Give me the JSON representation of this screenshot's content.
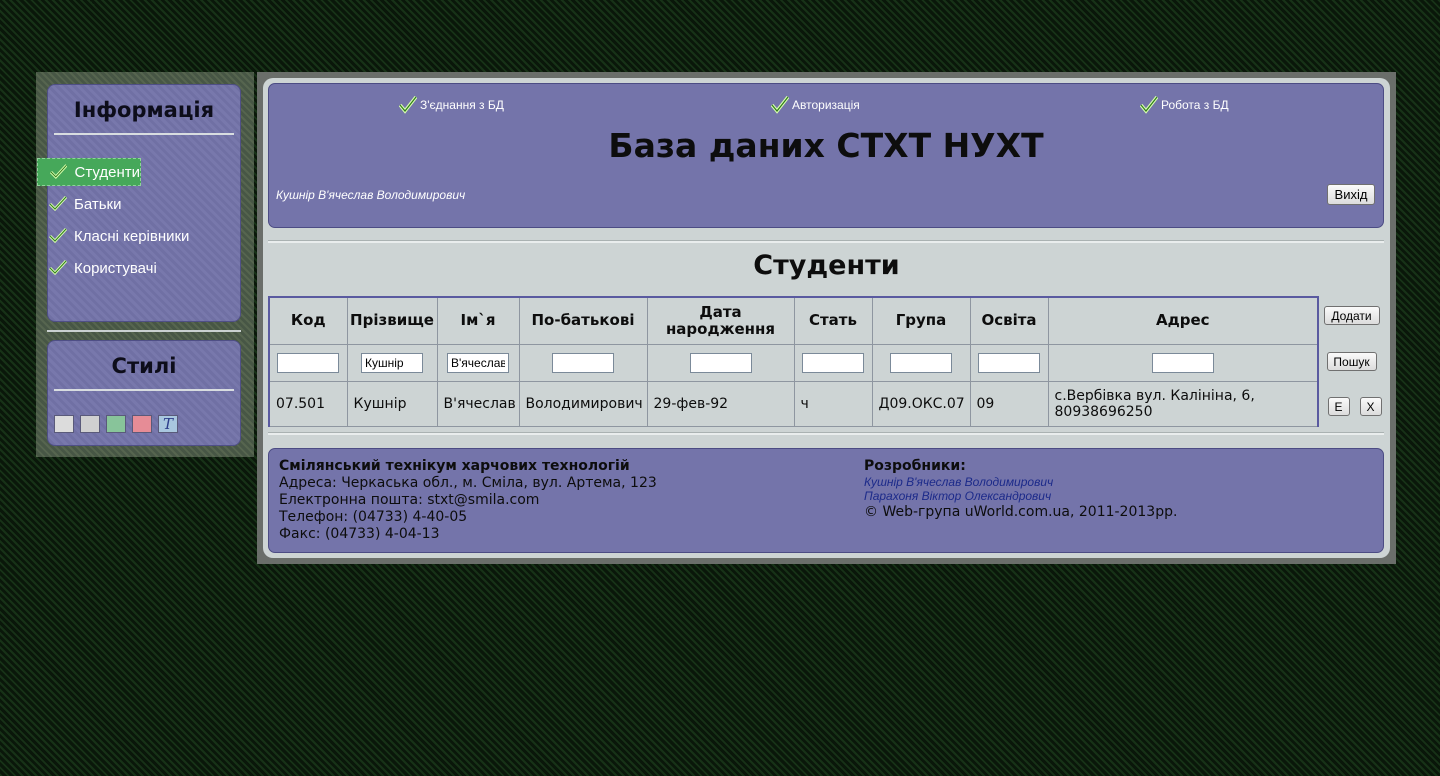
{
  "sidebar": {
    "info_title": "Інформація",
    "styles_title": "Стилі",
    "items": [
      {
        "label": "Студенти"
      },
      {
        "label": "Батьки"
      },
      {
        "label": "Класні керівники"
      },
      {
        "label": "Користувачі"
      }
    ],
    "swatches": [
      {
        "name": "light-gray",
        "color": "#dcdcdc"
      },
      {
        "name": "gray",
        "color": "#d0d0d0"
      },
      {
        "name": "green",
        "color": "#88c49a"
      },
      {
        "name": "pink",
        "color": "#e68c96"
      },
      {
        "name": "text",
        "color": "#a9c7df",
        "glyph": "T"
      }
    ]
  },
  "header": {
    "status": [
      {
        "label": "З'єднання з БД"
      },
      {
        "label": "Авторизація"
      },
      {
        "label": "Робота з БД"
      }
    ],
    "title": "База даних СТХТ НУХТ",
    "user": "Кушнір В'ячеслав Володимирович",
    "exit_label": "Вихід"
  },
  "section_title": "Студенти",
  "table": {
    "columns": [
      "Код",
      "Прізвище",
      "Ім`я",
      "По-батькові",
      "Дата народження",
      "Стать",
      "Група",
      "Освіта",
      "Адрес"
    ],
    "filters": [
      "",
      "Кушнір",
      "В'ячеслав",
      "",
      "",
      "",
      "",
      "",
      ""
    ],
    "add_label": "Додати",
    "search_label": "Пошук",
    "edit_label": "E",
    "delete_label": "X",
    "rows": [
      [
        "07.501",
        "Кушнір",
        "В'ячеслав",
        "Володимирович",
        "29-фев-92",
        "ч",
        "Д09.ОКС.07",
        "09",
        "с.Вербівка вул. Калініна, 6, 80938696250"
      ]
    ]
  },
  "footer": {
    "org": "Смілянський технікум харчових технологій",
    "address": "Адреса: Черкаська обл., м. Сміла, вул. Артема, 123",
    "email": "Електронна пошта: stxt@smila.com",
    "phone": "Телефон: (04733) 4-40-05",
    "fax": "Факс: (04733) 4-04-13",
    "devs_label": "Розробники:",
    "devs": [
      "Кушнір В'ячеслав Володимирович",
      "Парахоня Віктор Олександрович"
    ],
    "copyright": "© Web-група uWorld.com.ua, 2011-2013рр."
  },
  "colors": {
    "panel": "#7474aa",
    "accent_green": "#46a85a",
    "content_bg": "#cdd4d4",
    "page_bg": "#0c1f0c"
  }
}
